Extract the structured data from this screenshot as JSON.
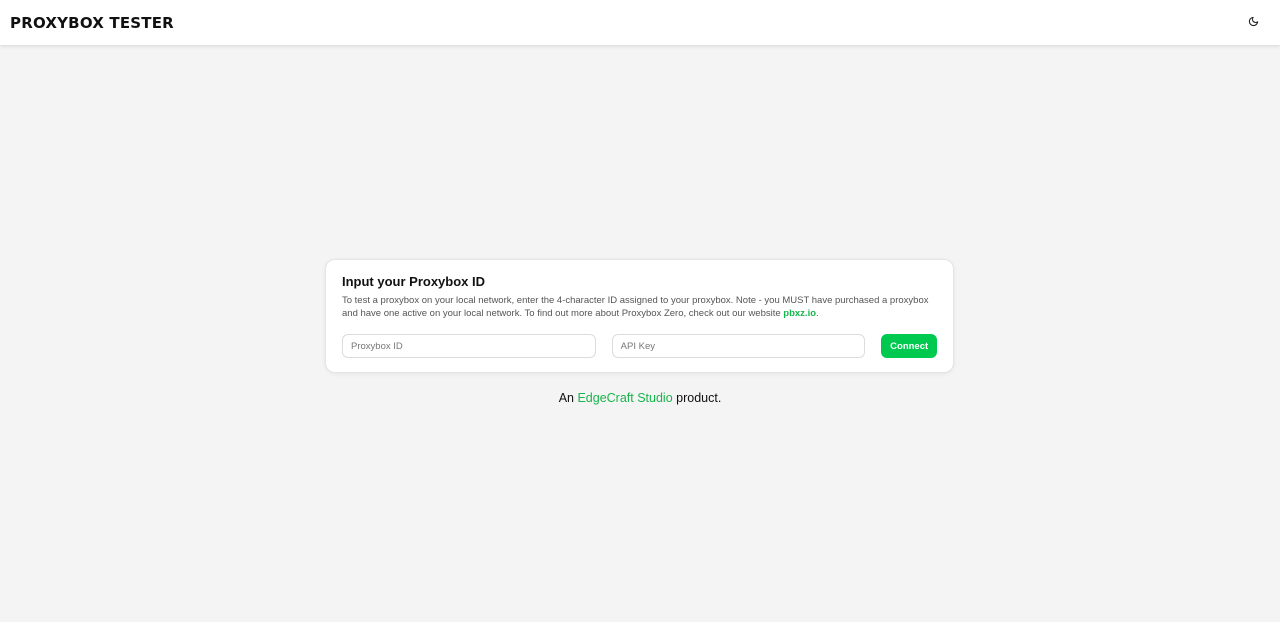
{
  "header": {
    "brand": "PROXYBOX TESTER",
    "theme_icon": "moon-icon"
  },
  "card": {
    "title": "Input your Proxybox ID",
    "description_prefix": "To test a proxybox on your local network, enter the 4-character ID assigned to your proxybox. Note - you MUST have purchased a proxybox and have one active on your local network. To find out more about Proxybox Zero, check out our website ",
    "website_link": "pbxz.io",
    "description_suffix": ".",
    "proxybox_id_placeholder": "Proxybox ID",
    "api_key_placeholder": "API Key",
    "connect_label": "Connect"
  },
  "footer": {
    "prefix": "An ",
    "studio_link": "EdgeCraft Studio",
    "suffix": " product."
  },
  "colors": {
    "accent": "#00c950",
    "link": "#19b44c",
    "background": "#f4f4f4"
  }
}
